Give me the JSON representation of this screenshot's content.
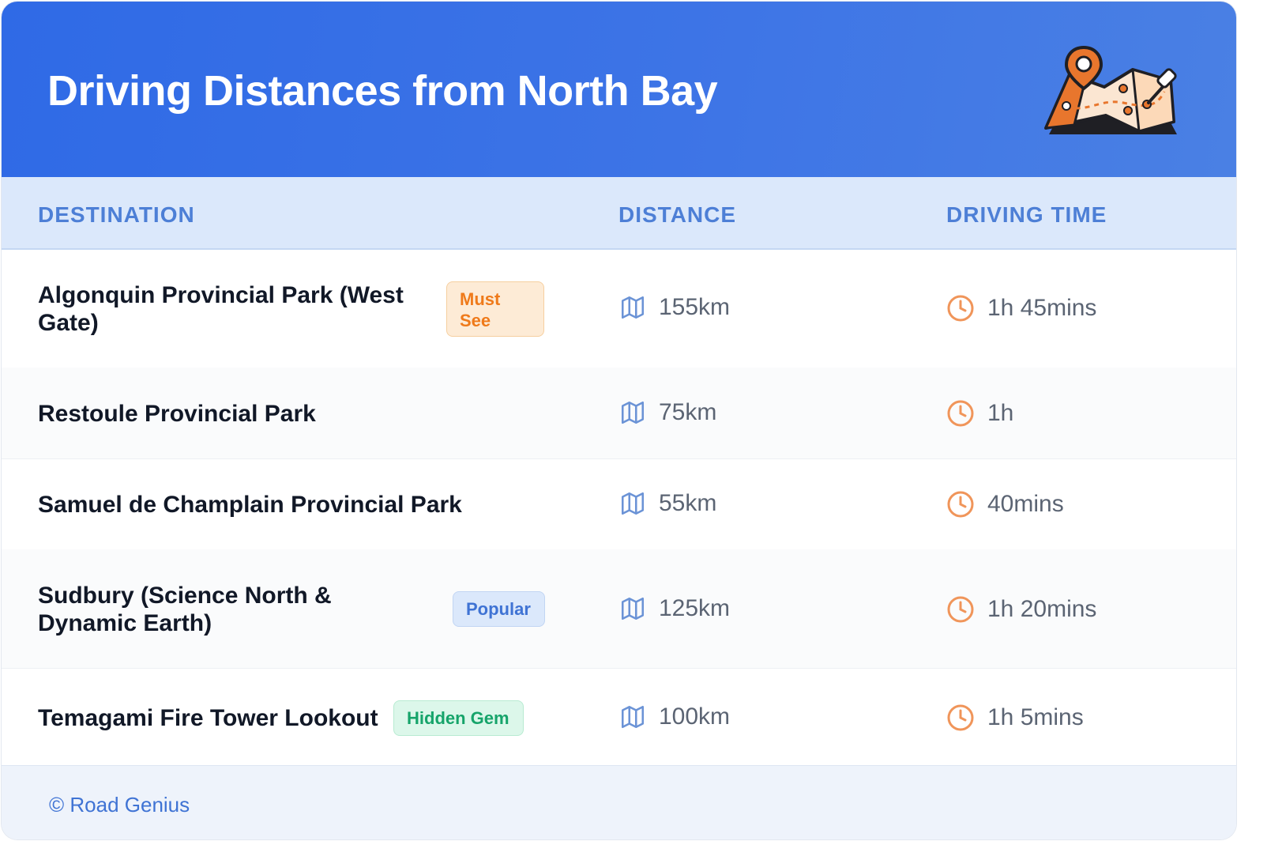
{
  "header": {
    "title": "Driving Distances from North Bay",
    "illustration_icon": "map-with-pins-icon"
  },
  "table": {
    "columns": [
      "DESTINATION",
      "DISTANCE",
      "DRIVING TIME"
    ],
    "rows": [
      {
        "destination": "Algonquin Provincial Park (West Gate)",
        "badge": "Must See",
        "badge_type": "must",
        "distance": "155km",
        "time": "1h 45mins"
      },
      {
        "destination": "Restoule Provincial Park",
        "badge": "",
        "badge_type": "",
        "distance": "75km",
        "time": "1h"
      },
      {
        "destination": "Samuel de Champlain Provincial Park",
        "badge": "",
        "badge_type": "",
        "distance": "55km",
        "time": "40mins"
      },
      {
        "destination": "Sudbury (Science North & Dynamic Earth)",
        "badge": "Popular",
        "badge_type": "popular",
        "distance": "125km",
        "time": "1h 20mins"
      },
      {
        "destination": "Temagami Fire Tower Lookout",
        "badge": "Hidden Gem",
        "badge_type": "gem",
        "distance": "100km",
        "time": "1h 5mins"
      }
    ]
  },
  "footer": {
    "credit": "© Road Genius"
  },
  "colors": {
    "header_blue": "#2f6ae6",
    "accent_orange": "#ef7a1a",
    "distance_icon": "#6b93d6",
    "time_icon": "#f0955a"
  },
  "icons": {
    "distance": "map-icon",
    "time": "clock-icon"
  }
}
